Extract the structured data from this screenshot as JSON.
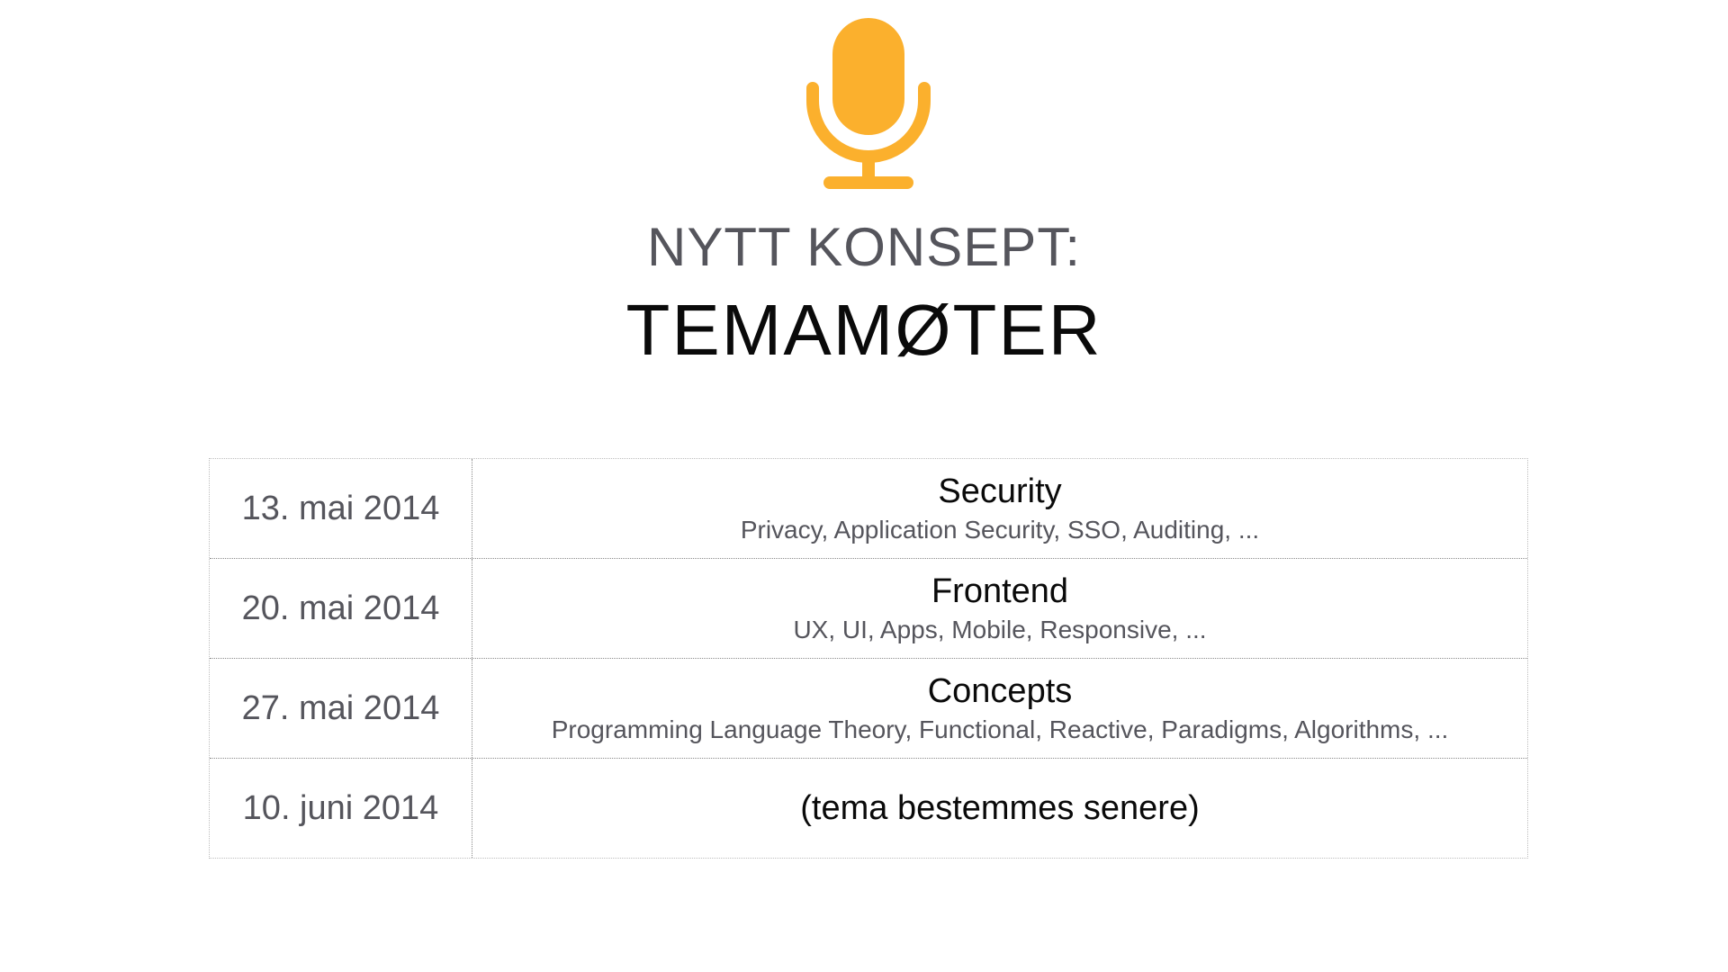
{
  "header": {
    "icon": "microphone-icon",
    "accent_color": "#FBB02D",
    "subtitle": "NYTT KONSEPT:",
    "title": "TEMAMØTER"
  },
  "schedule": [
    {
      "date": "13. mai 2014",
      "topic": "Security",
      "details": "Privacy, Application Security, SSO, Auditing, ..."
    },
    {
      "date": "20. mai 2014",
      "topic": "Frontend",
      "details": "UX, UI, Apps, Mobile, Responsive, ..."
    },
    {
      "date": "27. mai 2014",
      "topic": "Concepts",
      "details": "Programming Language Theory, Functional, Reactive, Paradigms, Algorithms, ..."
    },
    {
      "date": "10. juni 2014",
      "topic": "(tema bestemmes senere)",
      "details": ""
    }
  ]
}
